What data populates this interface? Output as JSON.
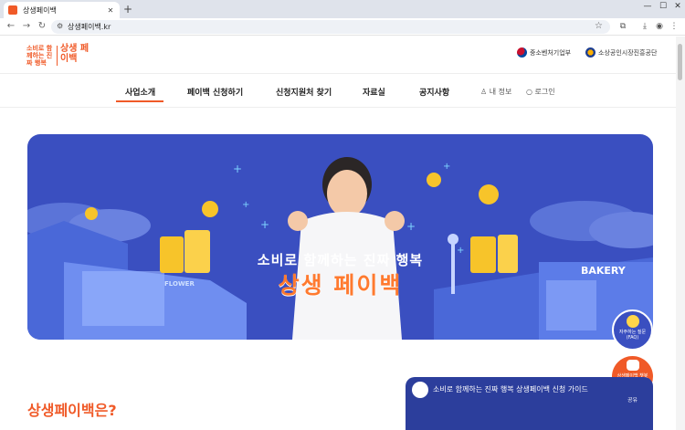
{
  "browser": {
    "tab_title": "상생페이백",
    "url": "상생페이백.kr"
  },
  "header": {
    "logo_small": "소비로 함께하는 진짜 행복",
    "logo_big": "상생 페이백",
    "gov_logo_1": "중소벤처기업부",
    "gov_logo_2": "소상공인시장진흥공단"
  },
  "nav": {
    "items": [
      {
        "label": "사업소개"
      },
      {
        "label": "페이백 신청하기"
      },
      {
        "label": "신청지원처 찾기"
      },
      {
        "label": "자료실"
      },
      {
        "label": "공지사항"
      }
    ],
    "my_info": "내 정보",
    "login": "로그인"
  },
  "hero": {
    "line1": "소비로 함께하는 진짜 행복",
    "line2": "상생 페이백",
    "sign_bakery": "BAKERY",
    "sign_flower": "FLOWER"
  },
  "floating": {
    "faq": "자주하는 질문(FAQ)",
    "chatbot": "상생페이백 챗봇"
  },
  "section": {
    "title": "상생페이백은?"
  },
  "video": {
    "title": "소비로 함께하는 진짜 행복 상생페이백 신청 가이드",
    "share": "공유"
  },
  "colors": {
    "brand": "#f05a28",
    "hero_bg": "#3a4fc0"
  }
}
